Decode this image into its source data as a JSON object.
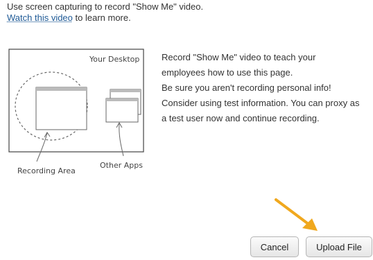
{
  "intro": {
    "line1": "Use screen capturing to record \"Show Me\" video.",
    "link_text": "Watch this video",
    "line2_suffix": " to learn more."
  },
  "illustration": {
    "desktop_label": "Your Desktop",
    "recording_area_label": "Recording Area",
    "other_apps_label": "Other Apps"
  },
  "description": {
    "lines": [
      "Record \"Show Me\" video to teach your",
      "employees how to use this page.",
      "Be sure you aren't recording personal info!",
      "Consider using test information. You can proxy as",
      "a test user now and continue recording."
    ]
  },
  "buttons": {
    "cancel": "Cancel",
    "upload": "Upload File"
  },
  "colors": {
    "link": "#1f5a96",
    "annotation_arrow": "#f0a81e",
    "sketch": "#444444"
  },
  "icons": {
    "annotation": "arrow-pointer-icon"
  }
}
